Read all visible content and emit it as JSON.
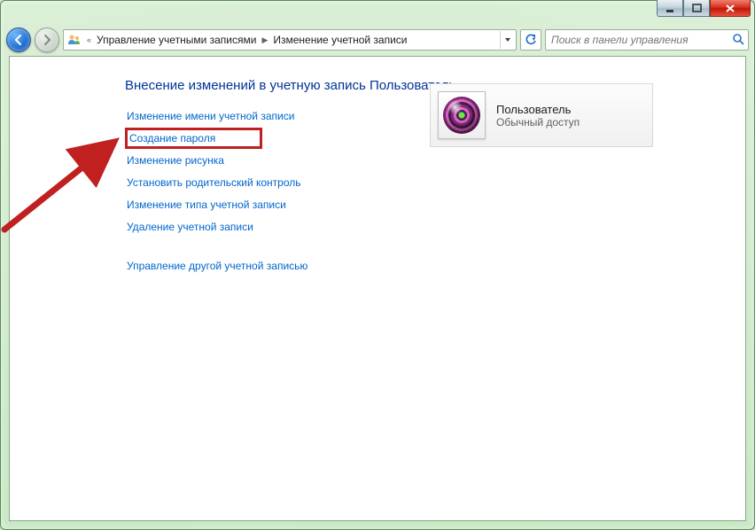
{
  "breadcrumb": {
    "level1": "Управление учетными записями",
    "level2": "Изменение учетной записи"
  },
  "search": {
    "placeholder": "Поиск в панели управления"
  },
  "page": {
    "heading": "Внесение изменений в учетную запись Пользователь",
    "links": {
      "rename": "Изменение имени учетной записи",
      "create_password": "Создание пароля",
      "change_picture": "Изменение рисунка",
      "parental": "Установить родительский контроль",
      "change_type": "Изменение типа учетной записи",
      "delete": "Удаление учетной записи",
      "manage_other": "Управление другой учетной записью"
    }
  },
  "user": {
    "name": "Пользователь",
    "type": "Обычный доступ"
  }
}
